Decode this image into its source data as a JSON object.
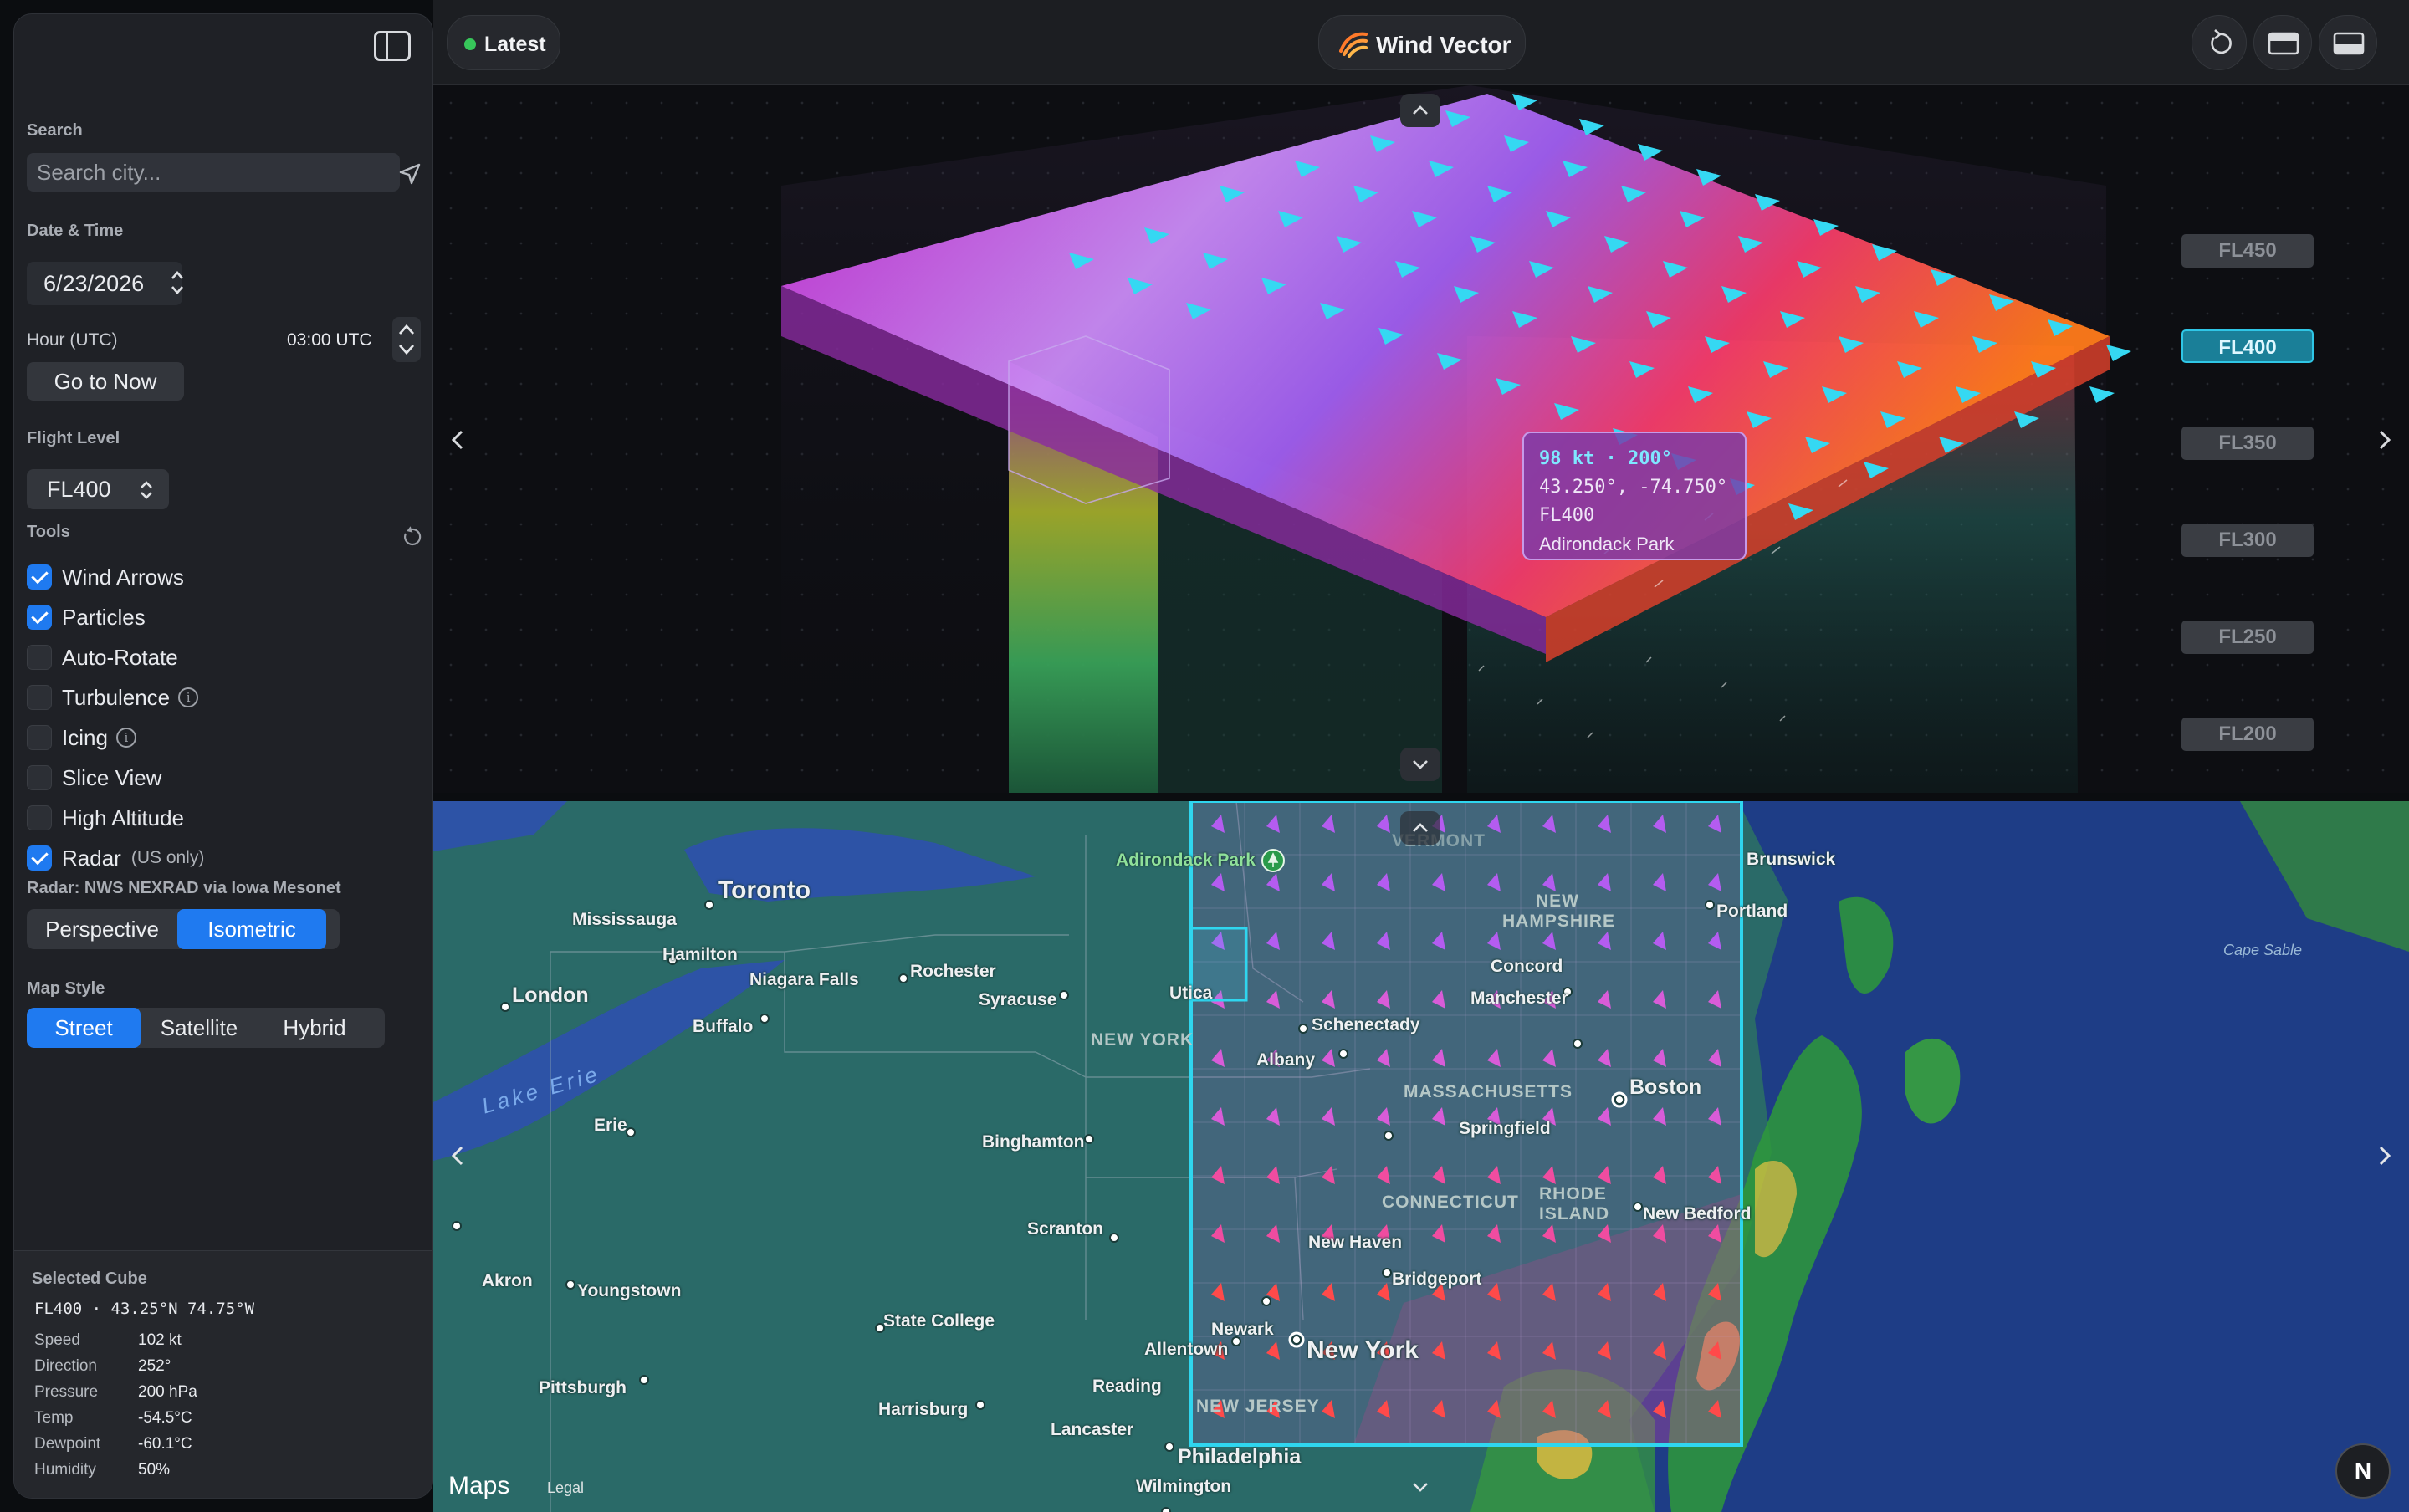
{
  "topbar": {
    "latest_label": "Latest",
    "brand_label": "Wind Vector"
  },
  "sidebar": {
    "search_label": "Search",
    "search_placeholder": "Search city...",
    "datetime_label": "Date & Time",
    "date_value": "6/23/2026",
    "hour_label": "Hour (UTC)",
    "hour_value": "03:00 UTC",
    "go_now_label": "Go to Now",
    "flight_level_label": "Flight Level",
    "flight_level_value": "FL400",
    "tools_label": "Tools",
    "tools": [
      {
        "label": "Wind Arrows",
        "checked": true
      },
      {
        "label": "Particles",
        "checked": true
      },
      {
        "label": "Auto-Rotate",
        "checked": false
      },
      {
        "label": "Turbulence",
        "checked": false
      },
      {
        "label": "Icing",
        "checked": false
      },
      {
        "label": "Slice View",
        "checked": false
      },
      {
        "label": "High Altitude",
        "checked": false
      },
      {
        "label": "Radar",
        "checked": true
      }
    ],
    "radar_note": "(US only)",
    "radar_source": "Radar: NWS NEXRAD via Iowa Mesonet",
    "projection": {
      "options": [
        "Perspective",
        "Isometric"
      ],
      "active": "Isometric"
    },
    "map_style_label": "Map Style",
    "map_style": {
      "options": [
        "Street",
        "Satellite",
        "Hybrid"
      ],
      "active": "Street"
    },
    "selected_cube": {
      "title": "Selected Cube",
      "location": "FL400 · 43.25°N 74.75°W",
      "rows": [
        {
          "key": "Speed",
          "value": "102 kt"
        },
        {
          "key": "Direction",
          "value": "252°"
        },
        {
          "key": "Pressure",
          "value": "200 hPa"
        },
        {
          "key": "Temp",
          "value": "-54.5°C"
        },
        {
          "key": "Dewpoint",
          "value": "-60.1°C"
        },
        {
          "key": "Humidity",
          "value": "50%"
        }
      ]
    }
  },
  "view3d": {
    "flight_levels": [
      "FL450",
      "FL400",
      "FL350",
      "FL300",
      "FL250",
      "FL200"
    ],
    "active_level": "FL400",
    "tooltip": {
      "speed_dir": "98 kt · 200°",
      "coords": "43.250°, -74.750°",
      "level": "FL400",
      "place": "Adirondack Park"
    }
  },
  "map": {
    "cities": [
      {
        "name": "Toronto",
        "size": "big"
      },
      {
        "name": "Mississauga",
        "size": "small"
      },
      {
        "name": "Hamilton",
        "size": "small"
      },
      {
        "name": "Niagara Falls",
        "size": "small"
      },
      {
        "name": "London",
        "size": "medium"
      },
      {
        "name": "Buffalo",
        "size": "small"
      },
      {
        "name": "Rochester",
        "size": "small"
      },
      {
        "name": "Syracuse",
        "size": "small"
      },
      {
        "name": "Utica",
        "size": "small"
      },
      {
        "name": "Schenectady",
        "size": "small"
      },
      {
        "name": "Albany",
        "size": "small"
      },
      {
        "name": "Erie",
        "size": "small"
      },
      {
        "name": "Binghamton",
        "size": "small"
      },
      {
        "name": "Scranton",
        "size": "small"
      },
      {
        "name": "Akron",
        "size": "small"
      },
      {
        "name": "Youngstown",
        "size": "small"
      },
      {
        "name": "State College",
        "size": "small"
      },
      {
        "name": "Pittsburgh",
        "size": "small"
      },
      {
        "name": "Harrisburg",
        "size": "small"
      },
      {
        "name": "Allentown",
        "size": "small"
      },
      {
        "name": "Reading",
        "size": "small"
      },
      {
        "name": "Lancaster",
        "size": "small"
      },
      {
        "name": "Philadelphia",
        "size": "medium"
      },
      {
        "name": "Wilmington",
        "size": "small"
      },
      {
        "name": "Newark",
        "size": "small"
      },
      {
        "name": "New York",
        "size": "big"
      },
      {
        "name": "New Haven",
        "size": "small"
      },
      {
        "name": "Bridgeport",
        "size": "small"
      },
      {
        "name": "Springfield",
        "size": "small"
      },
      {
        "name": "Boston",
        "size": "medium"
      },
      {
        "name": "Concord",
        "size": "small"
      },
      {
        "name": "Manchester",
        "size": "small"
      },
      {
        "name": "Portland",
        "size": "small"
      },
      {
        "name": "Brunswick",
        "size": "small"
      },
      {
        "name": "New Bedford",
        "size": "small"
      }
    ],
    "regions": [
      "NEW YORK",
      "MASSACHUSETTS",
      "CONNECTICUT",
      "RHODE",
      "ISLAND",
      "NEW",
      "HAMPSHIRE",
      "NEW JERSEY",
      "VERMONT"
    ],
    "water": [
      "Lake Erie"
    ],
    "cape": "Cape Sable",
    "poi": "Adirondack Park",
    "attribution": "Maps",
    "legal": "Legal",
    "compass": "N"
  },
  "colors": {
    "accent": "#1f7af0",
    "selection": "#2fd6ef",
    "sidebar_bg": "#1f2126",
    "map_land": "#2a6a68",
    "ocean": "#1e3d86"
  }
}
